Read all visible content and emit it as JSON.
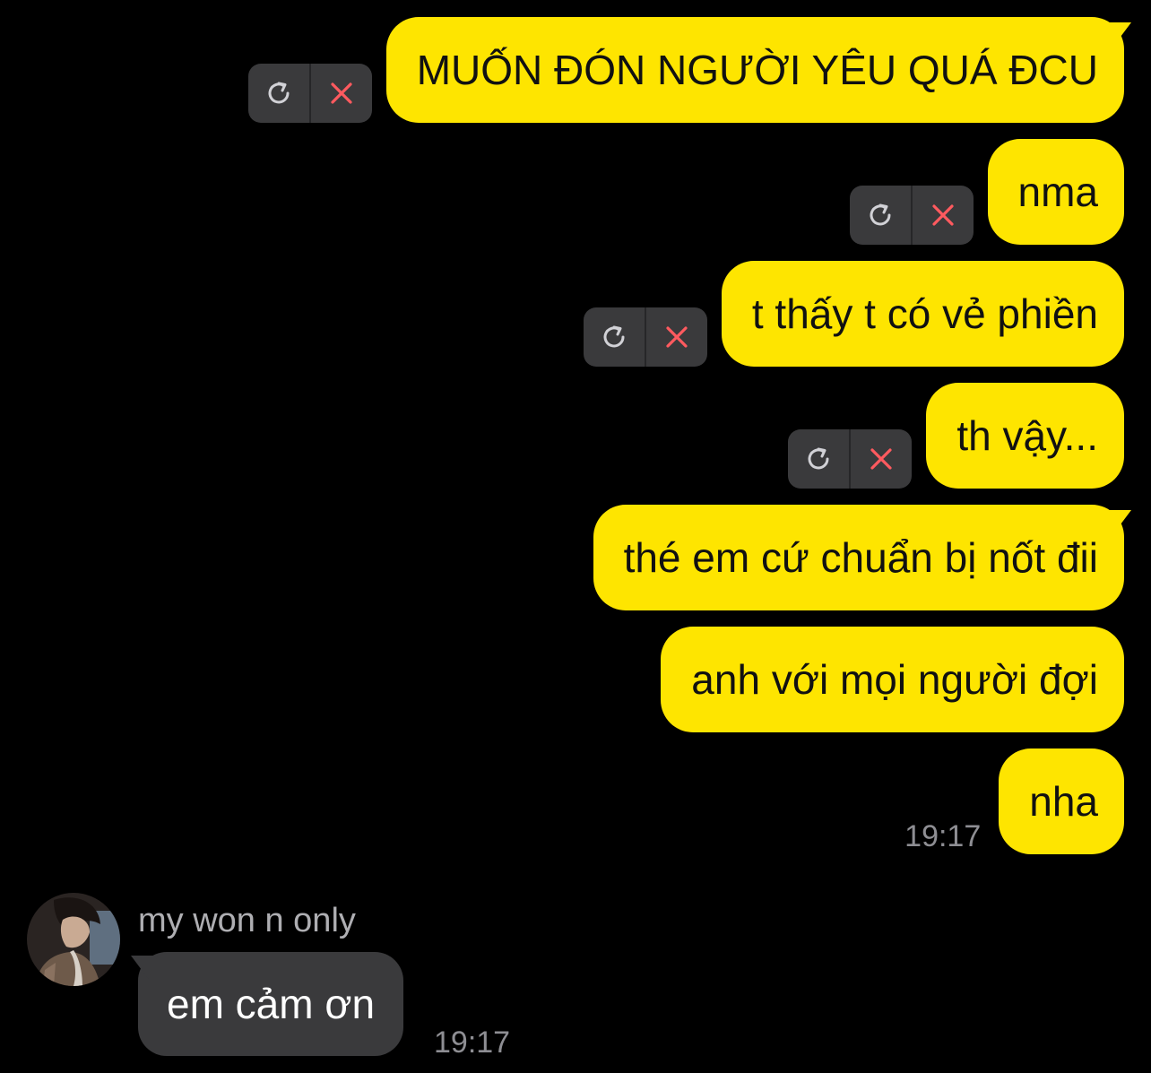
{
  "colors": {
    "background": "#000000",
    "outgoing_bubble": "#FEE500",
    "outgoing_text": "#111111",
    "incoming_bubble": "#3a3a3c",
    "incoming_text": "#ffffff",
    "timestamp": "#8e8e93",
    "retry_icon": "#d1d1d6",
    "delete_icon": "#ff5a5f"
  },
  "outgoing_messages": [
    {
      "text": "MUỐN ĐÓN NGƯỜI YÊU QUÁ ĐCU",
      "failed": true
    },
    {
      "text": "nma",
      "failed": true
    },
    {
      "text": "t thấy t có vẻ phiền",
      "failed": true
    },
    {
      "text": "th vậy...",
      "failed": true
    },
    {
      "text": "thé em cứ chuẩn bị nốt đii",
      "failed": false
    },
    {
      "text": "anh với mọi người đợi",
      "failed": false
    },
    {
      "text": "nha",
      "failed": false,
      "time": "19:17"
    }
  ],
  "failed_controls": {
    "retry_icon": "retry-icon",
    "delete_icon": "close-icon"
  },
  "incoming": {
    "sender": "my won n only",
    "text": "em cảm ơn",
    "time": "19:17"
  }
}
